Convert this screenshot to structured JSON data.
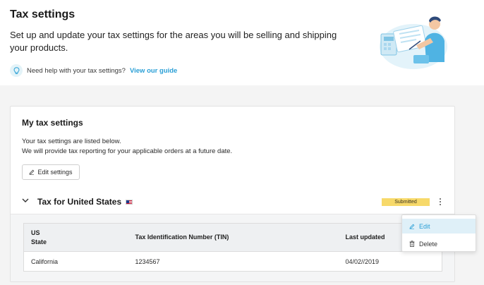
{
  "header": {
    "title": "Tax settings",
    "description": "Set up and update your tax settings for the areas you will be selling and shipping your products.",
    "help_text": "Need help with your tax settings?",
    "help_link": "View our guide"
  },
  "card": {
    "title": "My tax settings",
    "desc_line1": "Your tax settings are listed below.",
    "desc_line2": "We will provide tax reporting for your applicable orders at a future date.",
    "edit_settings_label": "Edit settings"
  },
  "section": {
    "title": "Tax for United States",
    "status": "Submitted",
    "table": {
      "col1_line1": "US",
      "col1_line2": "State",
      "col2": "Tax Identification Number (TIN)",
      "col3": "Last updated",
      "rows": [
        {
          "state": "California",
          "tin": "1234567",
          "updated": "04/02//2019"
        }
      ]
    }
  },
  "menu": {
    "edit_label": "Edit",
    "delete_label": "Delete"
  },
  "colors": {
    "accent": "#2a9fd6",
    "status_badge": "#f7d96a",
    "menu_highlight": "#dff0f8"
  },
  "icons": {
    "help": "lightbulb-icon",
    "edit": "pencil-icon",
    "delete": "trash-icon",
    "expand": "chevron-down-icon",
    "more": "more-vertical-icon",
    "flag": "us-flag-icon"
  }
}
